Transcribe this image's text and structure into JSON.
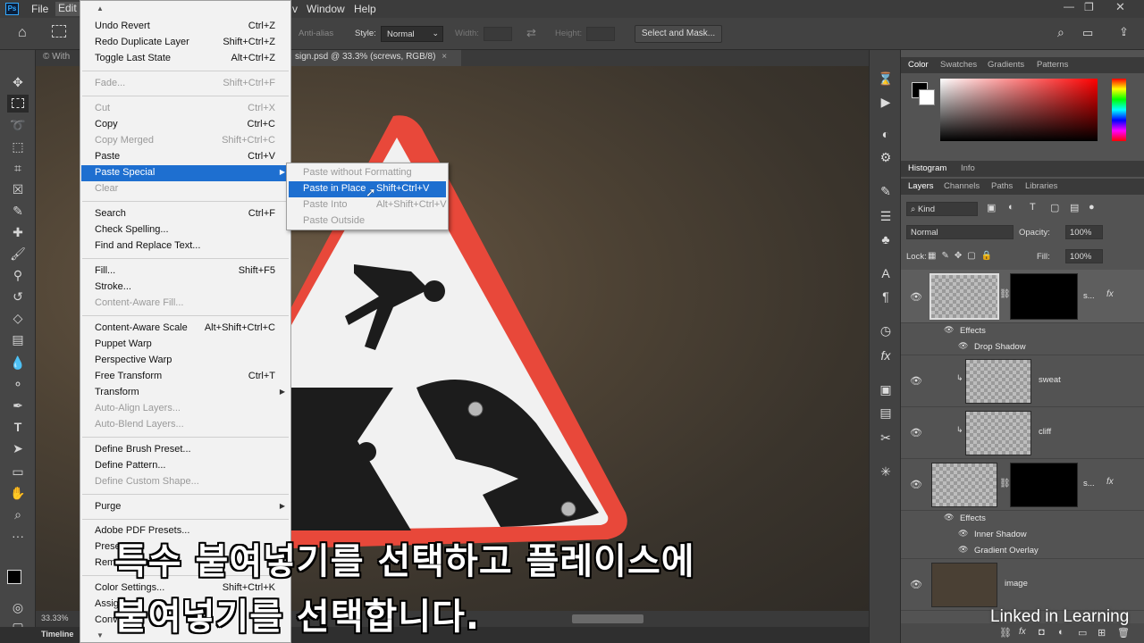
{
  "menubar": {
    "app_icon": "Ps",
    "items": [
      "File",
      "Edit",
      "v",
      "Window",
      "Help"
    ]
  },
  "options_bar": {
    "anti_alias": "Anti-alias",
    "style_label": "Style:",
    "style_value": "Normal",
    "width_label": "Width:",
    "height_label": "Height:",
    "select_mask_button": "Select and Mask..."
  },
  "document_tabs": {
    "tab1": "© With",
    "tab2": "sign.psd @ 33.3% (screws, RGB/8)",
    "tab2_close": "×"
  },
  "status": {
    "zoom": "33.33%",
    "timeline": "Timeline"
  },
  "edit_menu": {
    "items": [
      {
        "label": "Undo Revert",
        "shortcut": "Ctrl+Z",
        "disabled": false
      },
      {
        "label": "Redo Duplicate Layer",
        "shortcut": "Shift+Ctrl+Z",
        "disabled": false
      },
      {
        "label": "Toggle Last State",
        "shortcut": "Alt+Ctrl+Z",
        "disabled": false
      },
      {
        "label": "Fade...",
        "shortcut": "Shift+Ctrl+F",
        "disabled": true
      },
      {
        "label": "Cut",
        "shortcut": "Ctrl+X",
        "disabled": true
      },
      {
        "label": "Copy",
        "shortcut": "Ctrl+C",
        "disabled": false
      },
      {
        "label": "Copy Merged",
        "shortcut": "Shift+Ctrl+C",
        "disabled": true
      },
      {
        "label": "Paste",
        "shortcut": "Ctrl+V",
        "disabled": false
      },
      {
        "label": "Paste Special",
        "shortcut": "",
        "disabled": false,
        "highlighted": true
      },
      {
        "label": "Clear",
        "shortcut": "",
        "disabled": true
      },
      {
        "label": "Search",
        "shortcut": "Ctrl+F",
        "disabled": false
      },
      {
        "label": "Check Spelling...",
        "shortcut": "",
        "disabled": false
      },
      {
        "label": "Find and Replace Text...",
        "shortcut": "",
        "disabled": false
      },
      {
        "label": "Fill...",
        "shortcut": "Shift+F5",
        "disabled": false
      },
      {
        "label": "Stroke...",
        "shortcut": "",
        "disabled": false
      },
      {
        "label": "Content-Aware Fill...",
        "shortcut": "",
        "disabled": true
      },
      {
        "label": "Content-Aware Scale",
        "shortcut": "Alt+Shift+Ctrl+C",
        "disabled": false
      },
      {
        "label": "Puppet Warp",
        "shortcut": "",
        "disabled": false
      },
      {
        "label": "Perspective Warp",
        "shortcut": "",
        "disabled": false
      },
      {
        "label": "Free Transform",
        "shortcut": "Ctrl+T",
        "disabled": false
      },
      {
        "label": "Transform",
        "shortcut": "",
        "disabled": false
      },
      {
        "label": "Auto-Align Layers...",
        "shortcut": "",
        "disabled": true
      },
      {
        "label": "Auto-Blend Layers...",
        "shortcut": "",
        "disabled": true
      },
      {
        "label": "Define Brush Preset...",
        "shortcut": "",
        "disabled": false
      },
      {
        "label": "Define Pattern...",
        "shortcut": "",
        "disabled": false
      },
      {
        "label": "Define Custom Shape...",
        "shortcut": "",
        "disabled": true
      },
      {
        "label": "Purge",
        "shortcut": "",
        "disabled": false
      },
      {
        "label": "Adobe PDF Presets...",
        "shortcut": "",
        "disabled": false
      },
      {
        "label": "Prese",
        "shortcut": "",
        "disabled": false
      },
      {
        "label": "Rem",
        "shortcut": "",
        "disabled": false
      },
      {
        "label": "Color Settings...",
        "shortcut": "Shift+Ctrl+K",
        "disabled": false
      },
      {
        "label": "Assig",
        "shortcut": "",
        "disabled": false
      },
      {
        "label": "Conv",
        "shortcut": "",
        "disabled": false
      }
    ]
  },
  "paste_special_submenu": {
    "items": [
      {
        "label": "Paste without Formatting",
        "shortcut": "",
        "disabled": true
      },
      {
        "label": "Paste in Place",
        "shortcut": "Shift+Ctrl+V",
        "disabled": false,
        "highlighted": true
      },
      {
        "label": "Paste Into",
        "shortcut": "Alt+Shift+Ctrl+V",
        "disabled": true
      },
      {
        "label": "Paste Outside",
        "shortcut": "",
        "disabled": true
      }
    ]
  },
  "color_panel": {
    "tabs": [
      "Color",
      "Swatches",
      "Gradients",
      "Patterns"
    ],
    "foreground": "#000000",
    "background": "#ffffff"
  },
  "histogram_panel": {
    "tabs": [
      "Histogram",
      "Info"
    ]
  },
  "layers_panel": {
    "tabs": [
      "Layers",
      "Channels",
      "Paths",
      "Libraries"
    ],
    "filter_kind": "Kind",
    "blend_mode": "Normal",
    "opacity_label": "Opacity:",
    "opacity_value": "100%",
    "lock_label": "Lock:",
    "fill_label": "Fill:",
    "fill_value": "100%",
    "layers": [
      {
        "name": "s...",
        "effects_label": "Effects",
        "effects": [
          "Drop Shadow"
        ]
      },
      {
        "name": "sweat"
      },
      {
        "name": "cliff"
      },
      {
        "name": "s...",
        "effects_label": "Effects",
        "effects": [
          "Inner Shadow",
          "Gradient Overlay"
        ]
      },
      {
        "name": "image"
      }
    ]
  },
  "caption": {
    "line1": "특수 붙여넣기를 선택하고 플레이스에",
    "line2": "붙여넣기를 선택합니다."
  },
  "watermark": "Linked in Learning",
  "colors": {
    "menu_highlight": "#1e6fd0",
    "sign_border": "#e8483a",
    "app_dark": "#3c3c3c"
  }
}
